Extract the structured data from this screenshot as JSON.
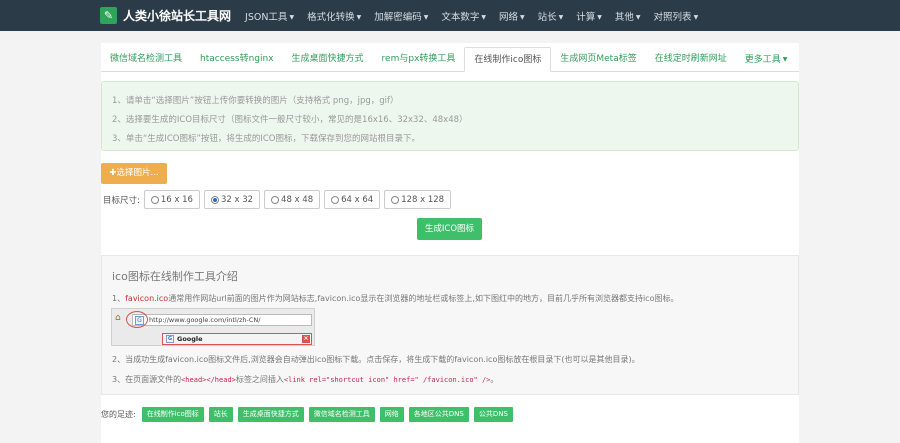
{
  "nav": {
    "brand_icon": "wrench",
    "title": "人类小徐站长工具网",
    "items": [
      "JSON工具",
      "格式化转换",
      "加解密编码",
      "文本数字",
      "网络",
      "站长",
      "计算",
      "其他",
      "对照列表"
    ]
  },
  "tabs": [
    "微信域名检测工具",
    "htaccess转nginx",
    "生成桌面快捷方式",
    "rem与px转换工具",
    "在线制作ico图标",
    "生成网页Meta标签",
    "在线定时刷新网址",
    "更多工具"
  ],
  "active_tab_index": 4,
  "instructions": [
    "1、请单击“选择图片”按钮上传你要转换的图片（支持格式 png，jpg，gif）",
    "2、选择要生成的ICO目标尺寸（图标文件一般尺寸较小，常见的是16x16、32x32、48x48）",
    "3、单击“生成ICO图标”按钮，将生成的ICO图标，下载保存到您的网站根目录下。"
  ],
  "pick_button": "选择图片...",
  "size_label": "目标尺寸:",
  "sizes": [
    "16 x 16",
    "32 x 32",
    "48 x 48",
    "64 x 64",
    "128 x 128"
  ],
  "selected_size_index": 1,
  "generate_button": "生成ICO图标",
  "intro": {
    "title": "ico图标在线制作工具介绍",
    "line1_prefix": "1、",
    "line1_red": "favicon.ico",
    "line1_rest": "通常用作网站url前面的图片作为网站标志,favicon.ico显示在浏览器的地址栏或标签上,如下图红中的地方，目前几乎所有浏览器都支持ico图标。",
    "browser_url": "http://www.google.com/intl/zh-CN/",
    "browser_tab": "Google",
    "line2": "2、当成功生成favicon.ico图标文件后,浏览器会自动弹出ico图标下载。点击保存，将生成下载的favicon.ico图标放在根目录下(也可以是其他目录)。",
    "line3_prefix": "3、在页面源文件的",
    "line3_code1": "<head></head>",
    "line3_mid": "标签之间插入",
    "line3_code2": "<link rel=\"shortcut icon\" href=\" /favicon.ico\" />",
    "line3_end": "。"
  },
  "footer": {
    "label": "您的足迹:",
    "links": [
      "在线制作ico图标",
      "站长",
      "生成桌面快捷方式",
      "微信域名检测工具",
      "网络",
      "各地区公共DNS",
      "公共DNS"
    ]
  }
}
